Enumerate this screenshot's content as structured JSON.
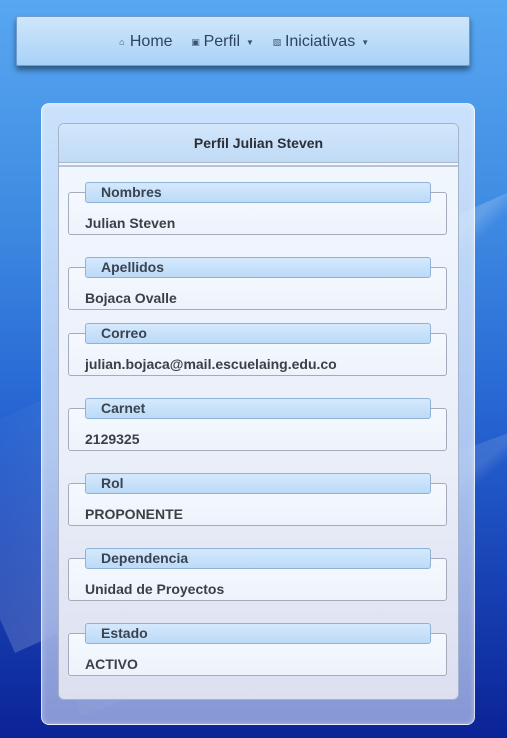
{
  "nav": {
    "home": {
      "label": "Home",
      "icon": "home-icon"
    },
    "perfil": {
      "label": "Perfil",
      "icon": "profile-card-icon"
    },
    "iniciativas": {
      "label": "Iniciativas",
      "icon": "initiatives-icon"
    }
  },
  "profile": {
    "title": "Perfil Julian Steven",
    "fields": [
      {
        "label": "Nombres",
        "value": "Julian Steven"
      },
      {
        "label": "Apellidos",
        "value": "Bojaca Ovalle"
      },
      {
        "label": "Correo",
        "value": "julian.bojaca@mail.escuelaing.edu.co"
      },
      {
        "label": "Carnet",
        "value": "2129325"
      },
      {
        "label": "Rol",
        "value": "PROPONENTE"
      },
      {
        "label": "Dependencia",
        "value": "Unidad de Proyectos"
      },
      {
        "label": "Estado",
        "value": "ACTIVO"
      }
    ]
  }
}
